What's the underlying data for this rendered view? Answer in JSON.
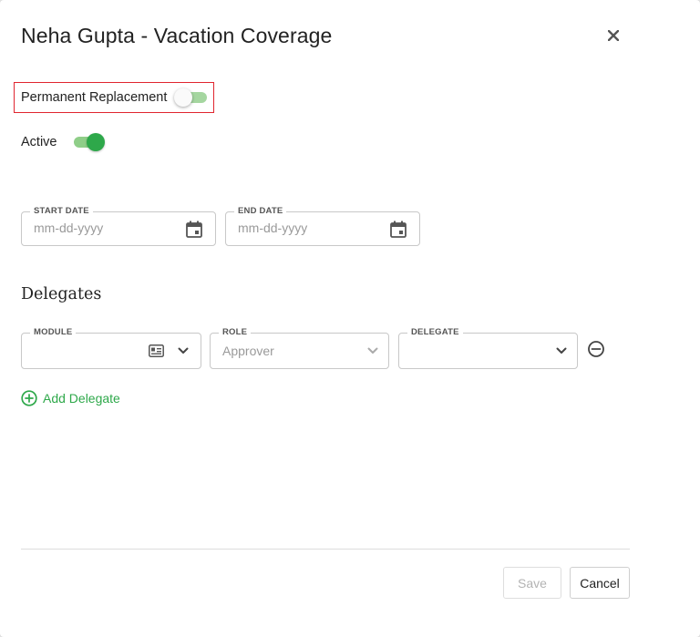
{
  "dialog": {
    "title": "Neha Gupta - Vacation Coverage",
    "close_icon": "close-icon"
  },
  "toggles": {
    "permanent_replacement": {
      "label": "Permanent Replacement",
      "checked": false
    },
    "active": {
      "label": "Active",
      "checked": true
    }
  },
  "dates": {
    "start": {
      "label": "START DATE",
      "placeholder": "mm-dd-yyyy",
      "icon": "calendar-icon"
    },
    "end": {
      "label": "END DATE",
      "placeholder": "mm-dd-yyyy",
      "icon": "calendar-icon"
    }
  },
  "delegates": {
    "title": "Delegates",
    "rows": [
      {
        "module": {
          "label": "MODULE",
          "value": "",
          "icon": "id-card-icon"
        },
        "role": {
          "label": "ROLE",
          "value": "Approver"
        },
        "delegate": {
          "label": "DELEGATE",
          "value": ""
        }
      }
    ],
    "add_label": "Add Delegate"
  },
  "footer": {
    "save_label": "Save",
    "cancel_label": "Cancel"
  },
  "colors": {
    "accent_green": "#2ea84a",
    "highlight_red": "#e0252f"
  }
}
